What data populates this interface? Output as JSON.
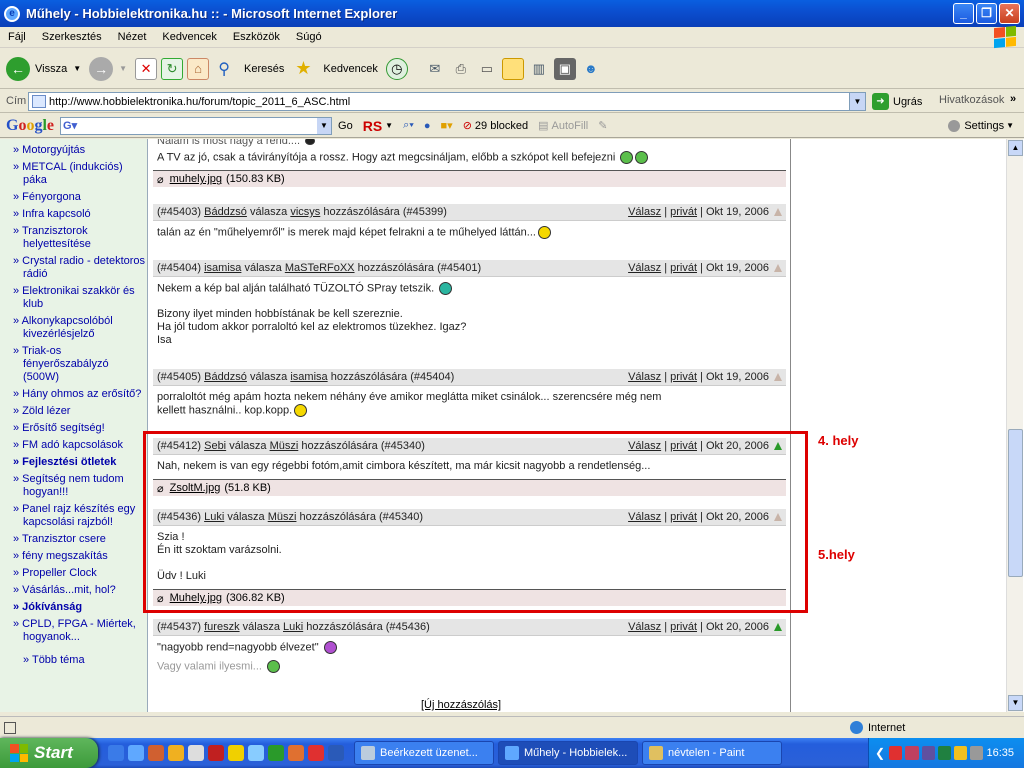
{
  "window": {
    "title": "Műhely - Hobbielektronika.hu :: - Microsoft Internet Explorer"
  },
  "menu": [
    "Fájl",
    "Szerkesztés",
    "Nézet",
    "Kedvencek",
    "Eszközök",
    "Súgó"
  ],
  "toolbar": {
    "back_label": "Vissza",
    "search_label": "Keresés",
    "favorites_label": "Kedvencek"
  },
  "address": {
    "label": "Cím",
    "url": "http://www.hobbielektronika.hu/forum/topic_2011_6_ASC.html",
    "go_label": "Ugrás",
    "links_label": "Hivatkozások"
  },
  "googlebar": {
    "logo": "Google",
    "go_label": "Go",
    "rs_label": "RS",
    "blocked_label": "29 blocked",
    "autofill_label": "AutoFill",
    "settings_label": "Settings"
  },
  "sidebar": {
    "items": [
      {
        "label": "» Motorgyújtás",
        "bold": false
      },
      {
        "label": "» METCAL (indukciós) páka",
        "bold": false
      },
      {
        "label": "» Fényorgona",
        "bold": false
      },
      {
        "label": "» Infra kapcsoló",
        "bold": false
      },
      {
        "label": "» Tranzisztorok helyettesítése",
        "bold": false
      },
      {
        "label": "» Crystal radio - detektoros rádió",
        "bold": false
      },
      {
        "label": "» Elektronikai szakkör és klub",
        "bold": false
      },
      {
        "label": "» Alkonykapcsolóból kivezérlésjelző",
        "bold": false
      },
      {
        "label": "» Triak-os fényerőszabályzó (500W)",
        "bold": false
      },
      {
        "label": "» Hány ohmos az erősítő?",
        "bold": false
      },
      {
        "label": "» Zöld lézer",
        "bold": false
      },
      {
        "label": "» Erősítő segítség!",
        "bold": false
      },
      {
        "label": "» FM adó kapcsolások",
        "bold": false
      },
      {
        "label": "» Fejlesztési ötletek",
        "bold": true
      },
      {
        "label": "» Segítség nem tudom hogyan!!!",
        "bold": false
      },
      {
        "label": "» Panel rajz készítés egy kapcsolási rajzból!",
        "bold": false
      },
      {
        "label": "» Tranzisztor csere",
        "bold": false
      },
      {
        "label": "» fény megszakítás",
        "bold": false
      },
      {
        "label": "» Propeller Clock",
        "bold": false
      },
      {
        "label": "» Vásárlás...mit, hol?",
        "bold": false
      },
      {
        "label": "» Jókívánság",
        "bold": true
      },
      {
        "label": "» CPLD, FPGA - Miértek, hogyanok...",
        "bold": false
      }
    ],
    "more_label": "» Több téma"
  },
  "forum": {
    "top_fragment": "Nálam is most nagy a rend....",
    "top_body": "A TV az jó, csak a távirányítója a rossz. Hogy azt megcsináljam, előbb a szkópot kell befejezni",
    "top_attachment": {
      "name": "muhely.jpg",
      "size": "(150.83 KB)"
    },
    "common": {
      "replies_to": "válasza",
      "comment_of": "hozzászólására",
      "reply": "Válasz",
      "private": "privát",
      "sep": "|"
    },
    "posts": [
      {
        "id": "(#45403)",
        "author": "Báddzsó",
        "target": "vicsys",
        "ref": "(#45399)",
        "date": "Okt 19, 2006",
        "body": [
          "talán az én \"műhelyemről\" is merek majd képet felrakni a te műhelyed láttán..."
        ]
      },
      {
        "id": "(#45404)",
        "author": "isamisa",
        "target": "MaSTeRFoXX",
        "ref": "(#45401)",
        "date": "Okt 19, 2006",
        "body": [
          "Nekem a kép bal alján található TÜZOLTÓ SPray tetszik.",
          "",
          "Bizony ilyet minden hobbístának be kell szereznie.",
          "Ha jól tudom akkor porraloltó kel az elektromos tüzekhez. Igaz?",
          "Isa"
        ]
      },
      {
        "id": "(#45405)",
        "author": "Báddzsó",
        "target": "isamisa",
        "ref": "(#45404)",
        "date": "Okt 19, 2006",
        "body": [
          "porraloltót még apám hozta nekem néhány éve amikor meglátta miket csinálok... szerencsére még nem",
          "kellett használni.. kop.kopp."
        ]
      },
      {
        "id": "(#45412)",
        "author": "Sebi",
        "target": "Müszi",
        "ref": "(#45340)",
        "date": "Okt 20, 2006",
        "body": [
          "Nah, nekem is van egy régebbi fotóm,amit cimbora készített, ma már kicsit nagyobb a rendetlenség..."
        ],
        "attachment": {
          "name": "ZsoltM.jpg",
          "size": "(51.8 KB)"
        }
      },
      {
        "id": "(#45436)",
        "author": "Luki",
        "target": "Müszi",
        "ref": "(#45340)",
        "date": "Okt 20, 2006",
        "body": [
          "Szia !",
          "Én itt szoktam varázsolni.",
          "",
          "Üdv ! Luki"
        ],
        "attachment": {
          "name": "Muhely.jpg",
          "size": "(306.82 KB)"
        }
      },
      {
        "id": "(#45437)",
        "author": "fureszk",
        "target": "Luki",
        "ref": "(#45436)",
        "date": "Okt 20, 2006",
        "body": [
          "\"nagyobb rend=nagyobb élvezet\""
        ],
        "grey": "Vagy valami ilyesmi..."
      }
    ],
    "new_post_label": "[Új hozzászólás]"
  },
  "annotations": {
    "first": "4. hely",
    "second": "5.hely"
  },
  "status": {
    "zone": "Internet"
  },
  "taskbar": {
    "start": "Start",
    "tasks": [
      "Beérkezett üzenet...",
      "Műhely - Hobbielek...",
      "névtelen - Paint"
    ],
    "clock": "16:35"
  },
  "colors": {
    "highlight": "#dd0000",
    "sidebar_bg": "#e8f3e6",
    "link": "#0000aa"
  }
}
